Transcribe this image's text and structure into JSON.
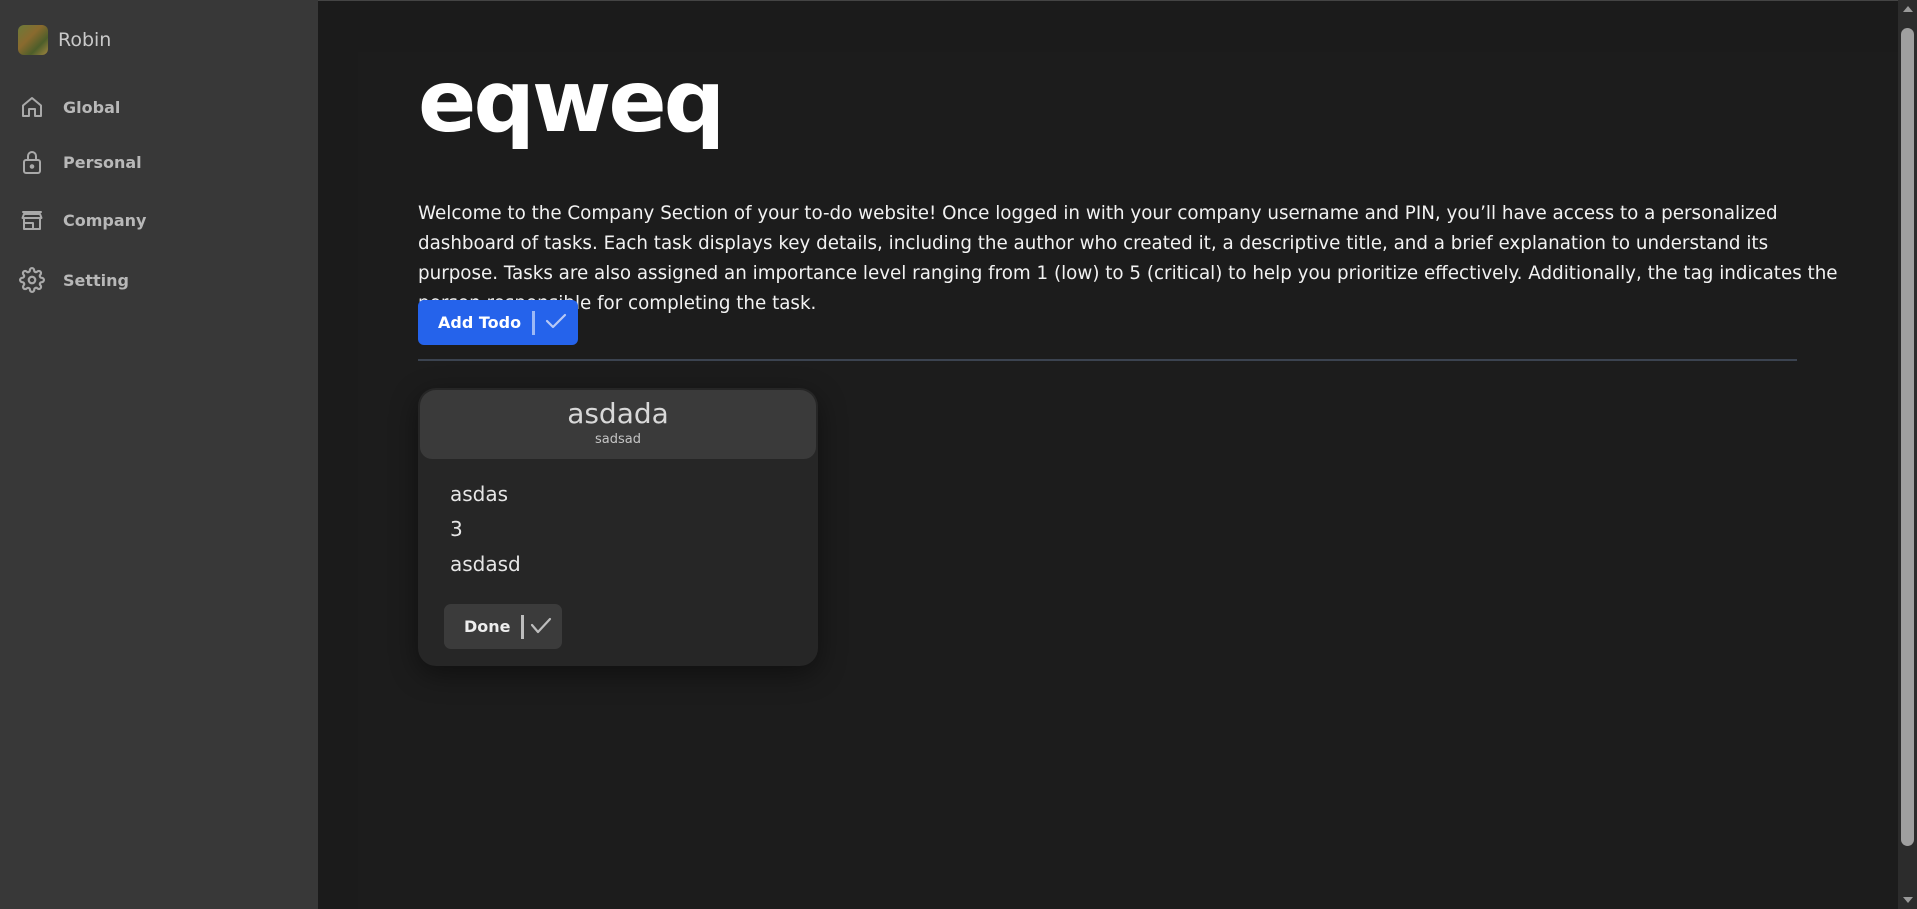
{
  "user": {
    "name": "Robin"
  },
  "sidebar": {
    "items": [
      {
        "label": "Global",
        "icon": "home-icon"
      },
      {
        "label": "Personal",
        "icon": "lock-icon"
      },
      {
        "label": "Company",
        "icon": "store-icon"
      },
      {
        "label": "Setting",
        "icon": "gear-icon"
      }
    ]
  },
  "main": {
    "title": "eqweq",
    "description": "Welcome to the Company Section of your to-do website! Once logged in with your company username and PIN, you’ll have access to a personalized dashboard of tasks. Each task displays key details, including the author who created it, a descriptive title, and a brief explanation to understand its purpose. Tasks are also assigned an importance level ranging from 1 (low) to 5 (critical) to help you prioritize effectively. Additionally, the tag indicates the person responsible for completing the task.",
    "add_button_label": "Add Todo"
  },
  "todos": [
    {
      "title": "asdada",
      "author": "sadsad",
      "description": "asdas",
      "importance": "3",
      "tag": "asdasd",
      "done_label": "Done"
    }
  ],
  "colors": {
    "sidebar_bg": "#383838",
    "page_bg": "#1b1b1b",
    "accent": "#2563eb",
    "card_bg": "#262626",
    "card_header_bg": "#3a3a3a"
  }
}
